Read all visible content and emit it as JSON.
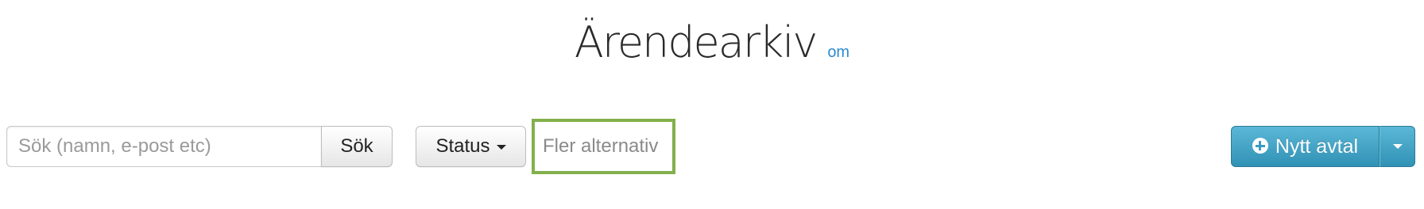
{
  "header": {
    "title": "Ärendearkiv",
    "about_link": "om",
    "link_color": "#2d8bd1"
  },
  "search": {
    "placeholder": "Sök (namn, e-post etc)",
    "button_label": "Sök"
  },
  "filters": {
    "status_label": "Status",
    "more_options_label": "Fler alternativ",
    "highlight_color": "#82b04c"
  },
  "actions": {
    "new_deal_label": "Nytt avtal",
    "new_deal_icon": "plus-circle-icon",
    "dropdown_icon": "caret-down-icon",
    "primary_color": "#3a9cc0"
  }
}
